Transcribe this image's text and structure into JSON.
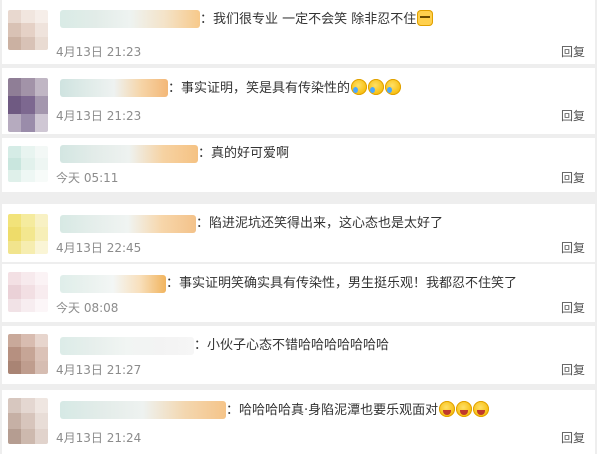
{
  "comments": [
    {
      "message": "：我们很专业 一定不会笑 除非忍不住",
      "emojis": [
        "cat"
      ],
      "time": "4月13日 21:23",
      "reply": "回复",
      "avatar_colors": [
        "#e8d8cf",
        "#f1e6df",
        "#f6eee9",
        "#d9c2b5",
        "#e5d1c6",
        "#efe3dc",
        "#cbb1a2",
        "#d8c2b6",
        "#e9dbd2"
      ],
      "nick_colors": [
        "#d9ebe6",
        "#e2ece8",
        "#eef3f1",
        "#f4e3c8",
        "#f7c98a"
      ]
    },
    {
      "message": "：事实证明，笑是具有传染性的",
      "emojis": [
        "cry",
        "cry",
        "cry"
      ],
      "time": "4月13日 21:23",
      "reply": "回复",
      "avatar_colors": [
        "#8f7e96",
        "#a293a8",
        "#c0b6c4",
        "#6f5a82",
        "#7d6890",
        "#a497ae",
        "#b6abbf",
        "#9a8caa",
        "#cfc7d4"
      ],
      "nick_colors": [
        "#cfe3e0",
        "#dfebe8",
        "#eef2f1",
        "#f6d5a8",
        "#f3b777"
      ]
    },
    {
      "message": "：真的好可爱啊",
      "emojis": [],
      "time": "今天 05:11",
      "reply": "回复",
      "avatar_colors": [
        "#d5ece6",
        "#e8f4f0",
        "#f3f8f6",
        "#c9e6de",
        "#e2f1ec",
        "#eef6f3",
        "#dff0ea",
        "#eef7f4",
        "#f7fbf9"
      ],
      "nick_colors": [
        "#d3e6e2",
        "#e3ece9",
        "#eef2f0",
        "#f6d2a2",
        "#f5c283"
      ]
    },
    {
      "message": "：陷进泥坑还笑得出来，这心态也是太好了",
      "emojis": [],
      "time": "4月13日 22:45",
      "reply": "回复",
      "avatar_colors": [
        "#f2e37a",
        "#f5eb9e",
        "#f8f1c4",
        "#eedc6a",
        "#f3e78f",
        "#f7efb8",
        "#f1e48d",
        "#f6edb0",
        "#faf5d6"
      ],
      "nick_colors": [
        "#d7e9e4",
        "#e5eeeb",
        "#f0f4f2",
        "#f7d6aa",
        "#f3c28a"
      ]
    },
    {
      "message": "：事实证明笑确实具有传染性，男生挺乐观！我都忍不住笑了",
      "emojis": [],
      "time": "今天 08:08",
      "reply": "回复",
      "avatar_colors": [
        "#f3e0e4",
        "#f7eaed",
        "#fbf3f5",
        "#ead1d7",
        "#f2dfe3",
        "#f8ecef",
        "#f1e2e6",
        "#f7edf0",
        "#fcf6f8"
      ],
      "nick_colors": [
        "#dfeeea",
        "#e9f1ee",
        "#f3f6f5",
        "#f8e0bd",
        "#f1b45e"
      ]
    },
    {
      "message": "：小伙子心态不错哈哈哈哈哈哈哈",
      "emojis": [],
      "time": "4月13日 21:27",
      "reply": "回复",
      "avatar_colors": [
        "#c9a99a",
        "#d8bcb0",
        "#e7d5cd",
        "#b69080",
        "#c6a596",
        "#dbc2b7",
        "#a98474",
        "#bf9d8e",
        "#d6bdb2"
      ],
      "nick_colors": [
        "#dcece8",
        "#e7efec",
        "#f1f5f3",
        "#f3f3f3",
        "#f6f6f6"
      ]
    },
    {
      "message": "：哈哈哈哈真·身陷泥潭也要乐观面对",
      "emojis": [
        "laugh",
        "laugh",
        "laugh"
      ],
      "time": "4月13日 21:24",
      "reply": "回复",
      "avatar_colors": [
        "#d7c7bf",
        "#e4d7d1",
        "#efe6e1",
        "#c6b0a5",
        "#d7c5bc",
        "#e8ddd7",
        "#b59d91",
        "#cdb9ae",
        "#e1d3cc"
      ],
      "nick_colors": [
        "#d6e9e5",
        "#e3ece9",
        "#eef2f0",
        "#f3d7b0",
        "#f5c489"
      ]
    }
  ]
}
